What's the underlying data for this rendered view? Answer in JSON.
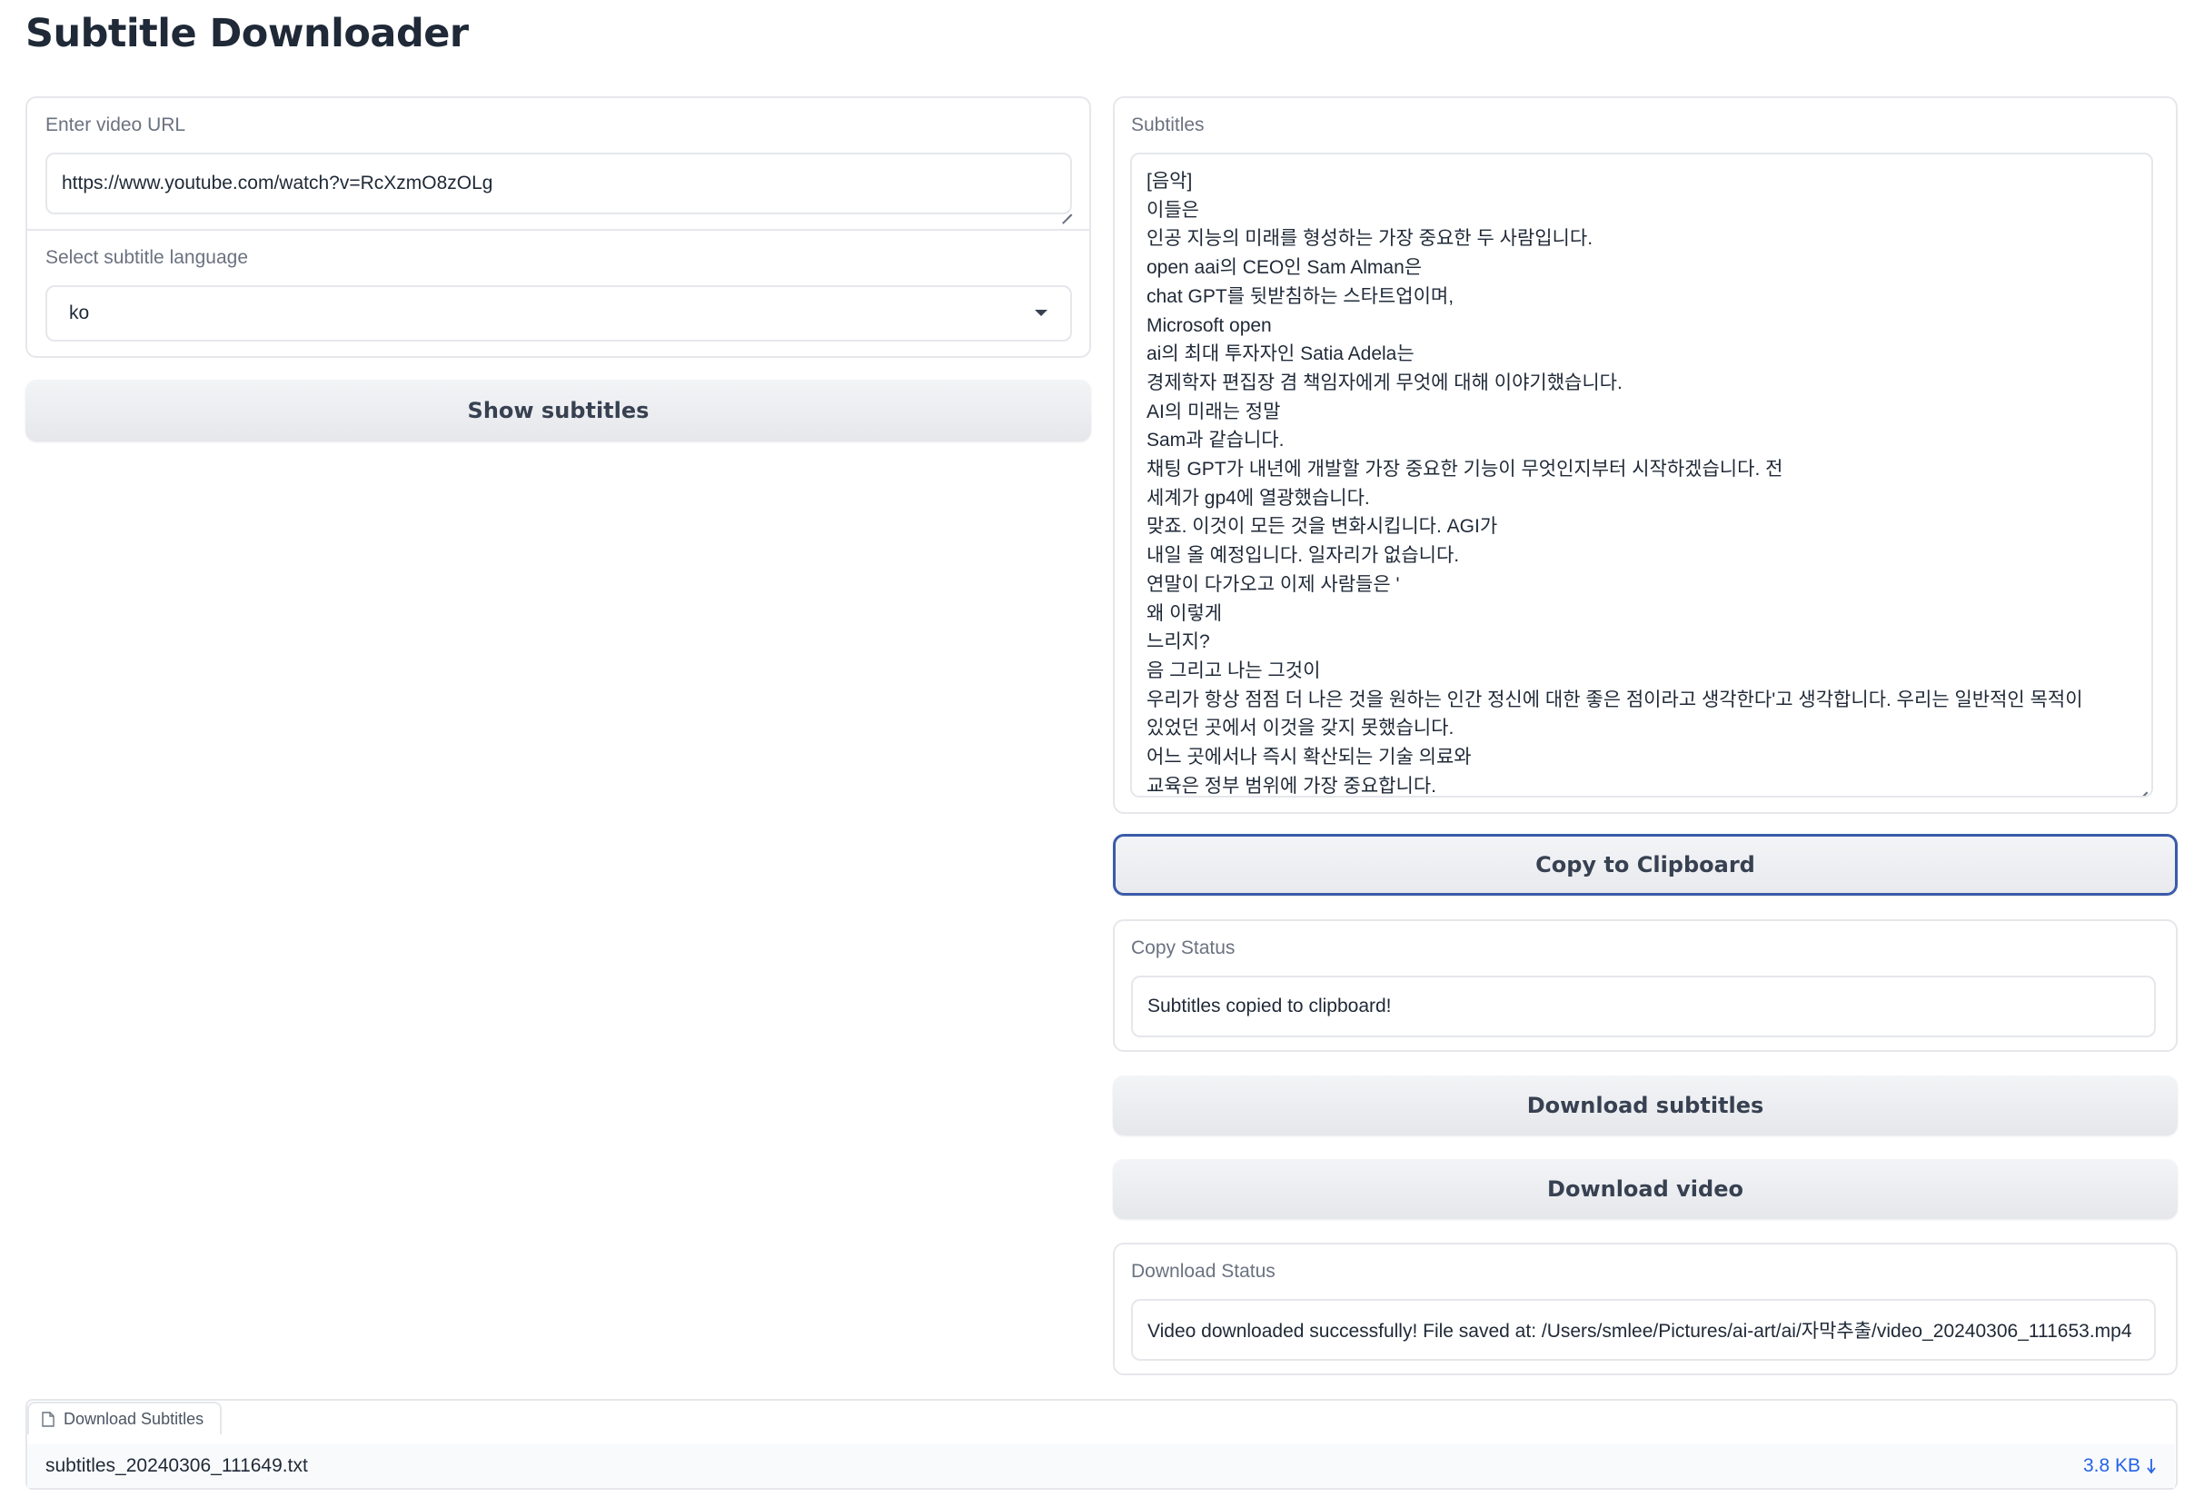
{
  "app": {
    "title": "Subtitle Downloader"
  },
  "url_block": {
    "label": "Enter video URL",
    "value": "https://www.youtube.com/watch?v=RcXzmO8zOLg"
  },
  "language_block": {
    "label": "Select subtitle language",
    "selected": "ko"
  },
  "show_button": {
    "label": "Show subtitles"
  },
  "subtitles_block": {
    "label": "Subtitles",
    "lines": [
      "[음악]",
      "이들은",
      "인공 지능의 미래를 형성하는 가장 중요한 두 사람입니다.",
      "open aai의 CEO인 Sam Alman은",
      "chat GPT를 뒷받침하는 스타트업이며,",
      "Microsoft open",
      "ai의 최대 투자자인 Satia Adela는",
      "경제학자 편집장 겸 책임자에게 무엇에 대해 이야기했습니다.",
      "AI의 미래는 정말",
      "Sam과 같습니다.",
      "채팅 GPT가 내년에 개발할 가장 중요한 기능이 무엇인지부터 시작하겠습니다. 전",
      "세계가 gp4에 열광했습니다.",
      "맞죠. 이것이 모든 것을 변화시킵니다. AGI가",
      "내일 올 예정입니다. 일자리가 없습니다.",
      "연말이 다가오고 이제 사람들은 '",
      "왜 이렇게",
      "느리지?",
      "음 그리고 나는 그것이",
      "우리가 항상 점점 더 나은 것을 원하는 인간 정신에 대한 좋은 점이라고 생각한다'고 생각합니다. 우리는 일반적인 목적이",
      "있었던 곳에서 이것을 갖지 못했습니다.",
      "어느 곳에서나 즉시 확산되는 기술 의료와",
      "교육은 정부 범위에 가장 중요합니다."
    ]
  },
  "copy_button": {
    "label": "Copy to Clipboard"
  },
  "copy_status": {
    "label": "Copy Status",
    "value": "Subtitles copied to clipboard!"
  },
  "download_subs_button": {
    "label": "Download subtitles"
  },
  "download_video_button": {
    "label": "Download video"
  },
  "download_status": {
    "label": "Download Status",
    "value": "Video downloaded successfully! File saved at: /Users/smlee/Pictures/ai-art/ai/자막추출/video_20240306_111653.mp4"
  },
  "file_output": {
    "tab_label": "Download Subtitles",
    "filename": "subtitles_20240306_111649.txt",
    "size": "3.8 KB",
    "icon": "file-icon",
    "download_icon": "download-arrow-icon"
  },
  "colors": {
    "focus_border": "#3b5ba9",
    "link": "#2563eb"
  }
}
